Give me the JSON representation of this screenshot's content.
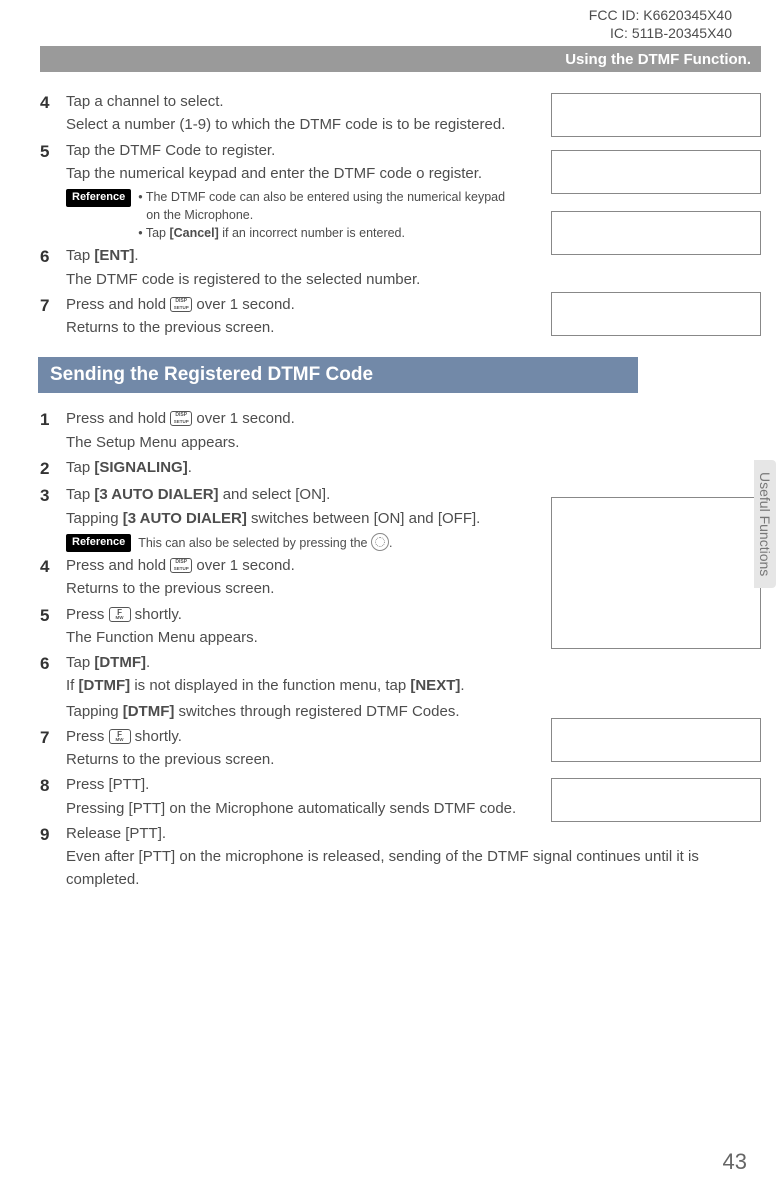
{
  "header": {
    "fcc": "FCC ID: K6620345X40",
    "ic": "IC: 511B-20345X40",
    "topbar": "Using the DTMF Function."
  },
  "section1": {
    "steps": {
      "4": {
        "title": "Tap a channel to select.",
        "desc": "Select a number (1-9) to which the DTMF code is to be registered."
      },
      "5": {
        "title": "Tap the DTMF Code to register.",
        "desc": "Tap the numerical keypad and enter the DTMF code o register.",
        "ref": {
          "label": "Reference",
          "b1": "• The DTMF code can also be entered using the numerical keypad on the Microphone.",
          "b2_pre": "• Tap ",
          "b2_bold": "[Cancel]",
          "b2_post": " if an incorrect number is entered."
        }
      },
      "6": {
        "title_pre": "Tap ",
        "title_bold": "[ENT]",
        "title_post": ".",
        "desc": "The DTMF code is registered to the selected number."
      },
      "7": {
        "title_pre": "Press and hold ",
        "title_post": " over 1 second.",
        "desc": "Returns to the previous screen."
      }
    }
  },
  "section2": {
    "heading": "Sending the Registered DTMF Code",
    "steps": {
      "1": {
        "title_pre": "Press and hold ",
        "title_post": " over 1 second.",
        "desc": "The Setup Menu appears."
      },
      "2": {
        "title_pre": "Tap ",
        "title_bold": "[SIGNALING]",
        "title_post": "."
      },
      "3": {
        "title_pre": "Tap ",
        "title_bold": "[3 AUTO DIALER]",
        "title_post": " and select [ON].",
        "desc_pre": "Tapping ",
        "desc_bold": "[3 AUTO DIALER]",
        "desc_post": " switches between [ON] and [OFF].",
        "ref": {
          "label": "Reference",
          "text_pre": "This can also be selected by pressing the ",
          "text_post": "."
        }
      },
      "4": {
        "title_pre": "Press and hold ",
        "title_post": " over 1 second.",
        "desc": "Returns to the previous screen."
      },
      "5": {
        "title_pre": "Press ",
        "title_post": " shortly.",
        "desc": "The Function Menu appears."
      },
      "6": {
        "title_pre": "Tap ",
        "title_bold": "[DTMF]",
        "title_post": ".",
        "desc1_pre": "If ",
        "desc1_bold": "[DTMF]",
        "desc1_mid": " is not displayed in the function menu, tap ",
        "desc1_bold2": "[NEXT]",
        "desc1_post": ".",
        "desc2_pre": "Tapping ",
        "desc2_bold": "[DTMF]",
        "desc2_post": " switches through registered DTMF Codes."
      },
      "7": {
        "title_pre": "Press ",
        "title_post": " shortly.",
        "desc": "Returns to the previous screen."
      },
      "8": {
        "title": "Press [PTT].",
        "desc": "Pressing [PTT] on the Microphone automatically sends DTMF code."
      },
      "9": {
        "title": "Release [PTT].",
        "desc": "Even after [PTT] on the microphone is released, sending of the DTMF signal continues until it is completed."
      }
    }
  },
  "sidetab": "Useful Functions",
  "pagenum": "43"
}
